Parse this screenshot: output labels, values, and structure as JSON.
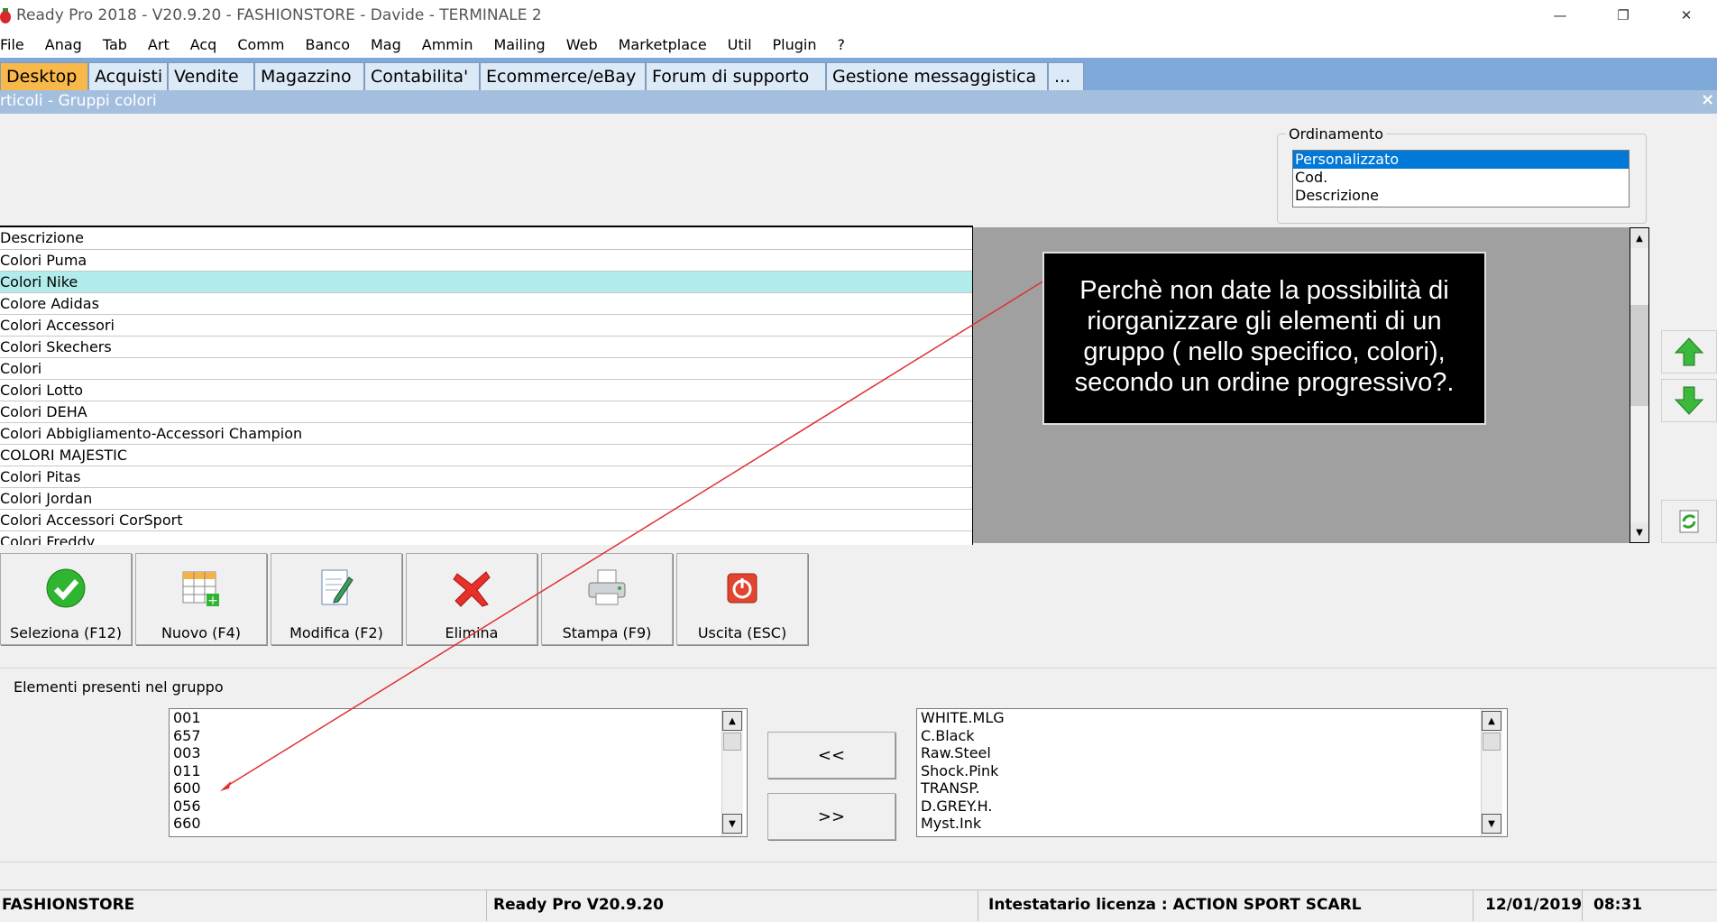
{
  "window": {
    "title": "Ready Pro 2018 - V20.9.20 - FASHIONSTORE - Davide - TERMINALE 2",
    "minimize": "—",
    "maximize": "❐",
    "close": "✕"
  },
  "menu": [
    "File",
    "Anag",
    "Tab",
    "Art",
    "Acq",
    "Comm",
    "Banco",
    "Mag",
    "Ammin",
    "Mailing",
    "Web",
    "Marketplace",
    "Util",
    "Plugin",
    "?"
  ],
  "tabs": [
    "Desktop",
    "Acquisti",
    "Vendite",
    "Magazzino",
    "Contabilita'",
    "Ecommerce/eBay",
    "Forum di supporto",
    "Gestione messaggistica",
    "..."
  ],
  "subwindow": {
    "title": "rticoli - Gruppi colori",
    "close": "×"
  },
  "ordinamento": {
    "label": "Ordinamento",
    "options": [
      "Personalizzato",
      "Cod.",
      "Descrizione"
    ],
    "selected": "Personalizzato"
  },
  "grid": {
    "header": "Descrizione",
    "rows": [
      "Colori Puma",
      "Colori Nike",
      "Colore Adidas",
      "Colori Accessori",
      "Colori Skechers",
      "Colori",
      "Colori Lotto",
      "Colori DEHA",
      "Colori Abbigliamento-Accessori Champion",
      "COLORI MAJESTIC",
      "Colori Pitas",
      "Colori Jordan",
      "Colori Accessori CorSport",
      "Colori Freddy"
    ],
    "selected_row": "Colori Nike"
  },
  "annotation": {
    "text": "Perchè non date la possibilità di riorganizzare gli elementi di un gruppo ( nello specifico, colori), secondo un ordine progressivo?.",
    "color": "#e03030"
  },
  "toolbar": {
    "seleziona": "Seleziona (F12)",
    "nuovo": "Nuovo (F4)",
    "modifica": "Modifica (F2)",
    "elimina": "Elimina",
    "stampa": "Stampa (F9)",
    "uscita": "Uscita (ESC)"
  },
  "elements": {
    "label": "Elementi presenti nel gruppo",
    "left_list": [
      "001",
      "657",
      "003",
      "011",
      "600",
      "056",
      "660"
    ],
    "right_list": [
      "WHITE.MLG",
      "C.Black",
      "Raw.Steel",
      "Shock.Pink",
      "TRANSP.",
      "D.GREY.H.",
      "Myst.Ink"
    ],
    "move_left": "<<",
    "move_right": ">>"
  },
  "status": {
    "company": "FASHIONSTORE",
    "version": "Ready Pro V20.9.20",
    "license": "Intestatario licenza : ACTION SPORT SCARL",
    "date": "12/01/2019",
    "time": "08:31"
  },
  "colors": {
    "tab_active": "#f8b84a",
    "tab_bar": "#7fa9d9",
    "selected_row": "#b2ebeb",
    "selection": "#0078d7"
  }
}
